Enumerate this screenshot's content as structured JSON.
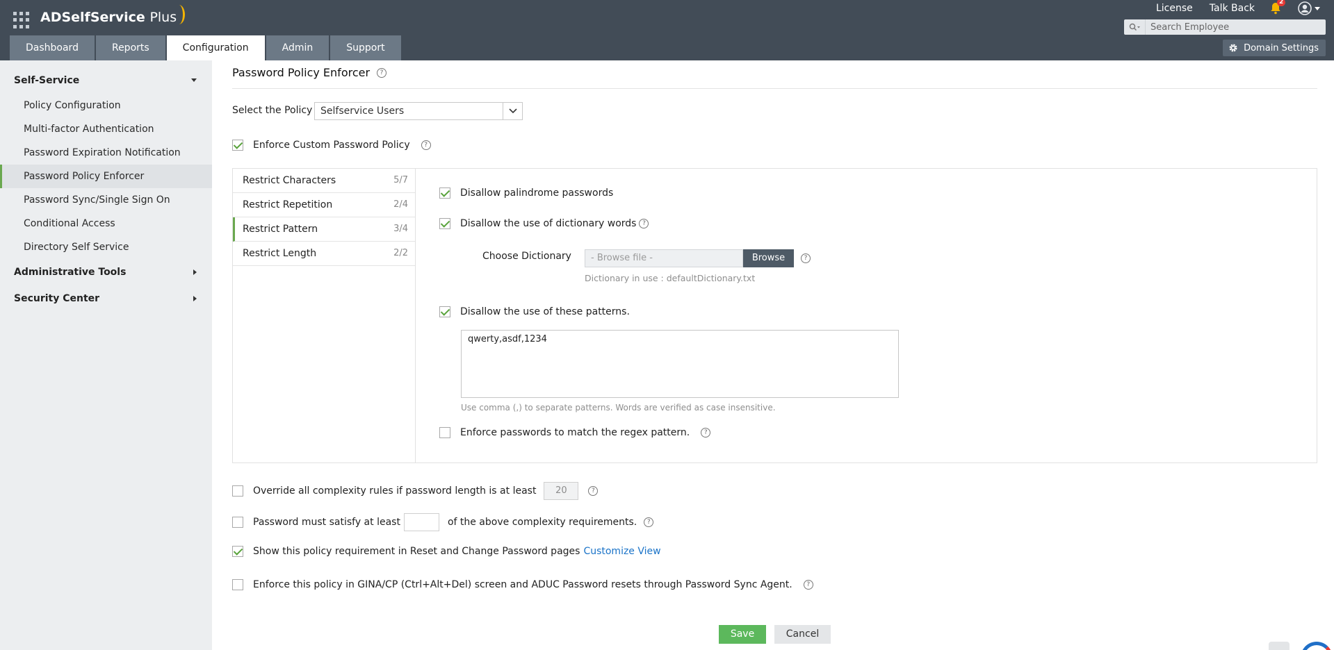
{
  "header": {
    "app_name": "ADSelfService",
    "app_name_suffix": "Plus",
    "links": [
      "License",
      "Talk Back"
    ],
    "notification_count": "2",
    "search_placeholder": "Search Employee",
    "tabs": [
      {
        "label": "Dashboard",
        "active": false
      },
      {
        "label": "Reports",
        "active": false
      },
      {
        "label": "Configuration",
        "active": true
      },
      {
        "label": "Admin",
        "active": false
      },
      {
        "label": "Support",
        "active": false
      }
    ],
    "domain_settings_label": "Domain Settings"
  },
  "sidebar": {
    "self_service": {
      "label": "Self-Service",
      "items": [
        {
          "label": "Policy Configuration"
        },
        {
          "label": "Multi-factor Authentication"
        },
        {
          "label": "Password Expiration Notification"
        },
        {
          "label": "Password Policy Enforcer",
          "active": true
        },
        {
          "label": "Password Sync/Single Sign On"
        },
        {
          "label": "Conditional Access"
        },
        {
          "label": "Directory Self Service"
        }
      ]
    },
    "administrative_tools": "Administrative Tools",
    "security_center": "Security Center"
  },
  "main": {
    "title": "Password Policy Enforcer",
    "select_policy_label": "Select the Policy",
    "selected_policy": "Selfservice Users",
    "enforce_custom_label": "Enforce Custom Password Policy",
    "enforce_custom_checked": true,
    "subtabs": [
      {
        "label": "Restrict Characters",
        "count": "5/7"
      },
      {
        "label": "Restrict Repetition",
        "count": "2/4"
      },
      {
        "label": "Restrict Pattern",
        "count": "3/4",
        "active": true
      },
      {
        "label": "Restrict Length",
        "count": "2/2"
      }
    ],
    "pattern_options": {
      "palindrome": {
        "label": "Disallow palindrome passwords",
        "checked": true
      },
      "dictionary": {
        "label": "Disallow the use of dictionary words",
        "checked": true
      },
      "choose_dictionary_label": "Choose Dictionary",
      "browse_placeholder": "- Browse file -",
      "browse_button": "Browse",
      "dictionary_in_use": "Dictionary in use : defaultDictionary.txt",
      "patterns": {
        "label": "Disallow the use of these patterns.",
        "checked": true
      },
      "patterns_value": "qwerty,asdf,1234",
      "patterns_hint": "Use comma (,) to separate patterns. Words are verified as case insensitive.",
      "regex": {
        "label": "Enforce passwords to match the regex pattern.",
        "checked": false
      }
    },
    "override": {
      "label": "Override all complexity rules if password length is at least",
      "value": "20",
      "checked": false
    },
    "satisfy": {
      "label_before": "Password must satisfy at least",
      "label_after": "of the above complexity requirements.",
      "value": "",
      "checked": false
    },
    "show_policy": {
      "label": "Show this policy requirement in Reset and Change Password pages",
      "link": "Customize View",
      "checked": true
    },
    "gina": {
      "label": "Enforce this policy in GINA/CP (Ctrl+Alt+Del) screen and ADUC Password resets through Password Sync Agent.",
      "checked": false
    },
    "save_label": "Save",
    "cancel_label": "Cancel"
  },
  "colors": {
    "header_bg": "#424c57",
    "tab_bg": "#6c7986",
    "sidebar_bg": "#eceef0",
    "accent_green": "#5cb85c",
    "link_blue": "#1a73c8"
  }
}
